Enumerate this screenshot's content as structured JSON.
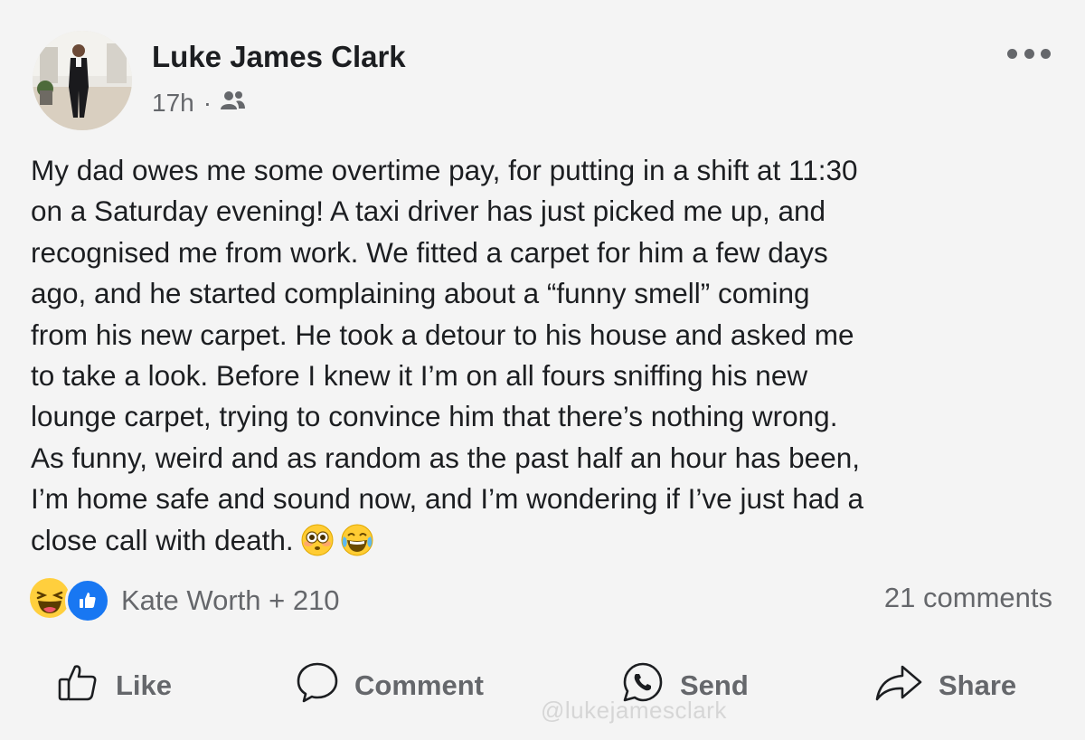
{
  "post": {
    "author": "Luke James Clark",
    "time": "17h",
    "separator": "·",
    "privacy_icon": "friends-icon",
    "lines": [
      "My dad owes me some overtime pay, for putting in a shift at 11:30",
      "on a Saturday evening! A taxi driver has just picked me up, and",
      "recognised me from work. We fitted a carpet for him a few days",
      "ago, and he started complaining about a “funny smell” coming",
      "from his new carpet. He took a detour to his house and asked me",
      "to take a look. Before I knew it I’m on all fours sniffing his new",
      "lounge carpet, trying to convince him that there’s nothing wrong.",
      "As funny, weird and as random as the past half an hour has been,",
      "I’m home safe and sound now, and I’m wondering if I’ve just had a",
      "close call with death."
    ],
    "end_emojis": [
      "flushed-face-emoji",
      "tears-of-joy-emoji"
    ]
  },
  "reactions": {
    "icons": [
      "haha-reaction-icon",
      "like-reaction-icon"
    ],
    "summary": "Kate Worth + 210",
    "comments": "21 comments"
  },
  "actions": {
    "like": "Like",
    "comment": "Comment",
    "send": "Send",
    "share": "Share"
  },
  "watermark": "@lukejamesclark",
  "colors": {
    "text": "#1c1e21",
    "secondary": "#65676b",
    "like_blue": "#1877f2",
    "background": "#f4f4f4"
  }
}
